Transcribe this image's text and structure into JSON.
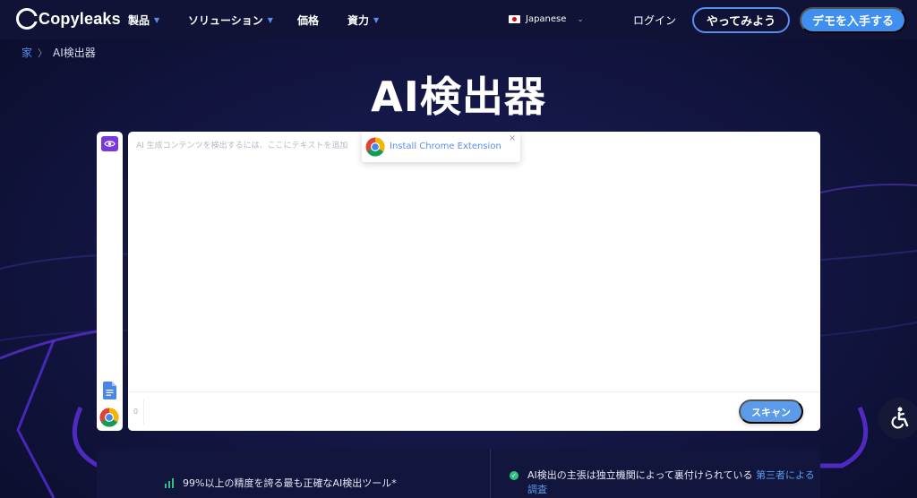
{
  "nav": {
    "logo": "Copyleaks",
    "items": [
      {
        "label": "製品",
        "has_caret": true
      },
      {
        "label": "ソリューション",
        "has_caret": true
      },
      {
        "label": "価格",
        "has_caret": false
      },
      {
        "label": "資力",
        "has_caret": true
      }
    ],
    "language": "Japanese",
    "login": "ログイン",
    "try_button": "やってみよう",
    "demo_button": "デモを入手する"
  },
  "breadcrumb": {
    "home": "家",
    "separator": "〉",
    "current": "AI検出器"
  },
  "page_title": "AI検出器",
  "editor": {
    "placeholder": "AI 生成コンテンツを検出するには、ここにテキストを追加",
    "char_count": "0",
    "scan_button": "スキャン"
  },
  "extension_popup": {
    "label": "Install Chrome Extension",
    "close": "×"
  },
  "features": {
    "item1": "99%以上の精度を誇る最も正確なAI検出ツール*",
    "item2_text": "AI検出の主張は独立機関によって裏付けられている",
    "item2_link": "第三者による調査"
  },
  "colors": {
    "accent": "#3e8ff0",
    "link": "#5b8def",
    "purple": "#7a38d8",
    "success": "#2ec27e",
    "background": "#0e1133"
  },
  "icons": [
    "eye-icon",
    "google-docs-icon",
    "chrome-icon",
    "close-icon",
    "bar-chart-icon",
    "check-circle-icon",
    "accessibility-icon",
    "flag-japan-icon"
  ]
}
